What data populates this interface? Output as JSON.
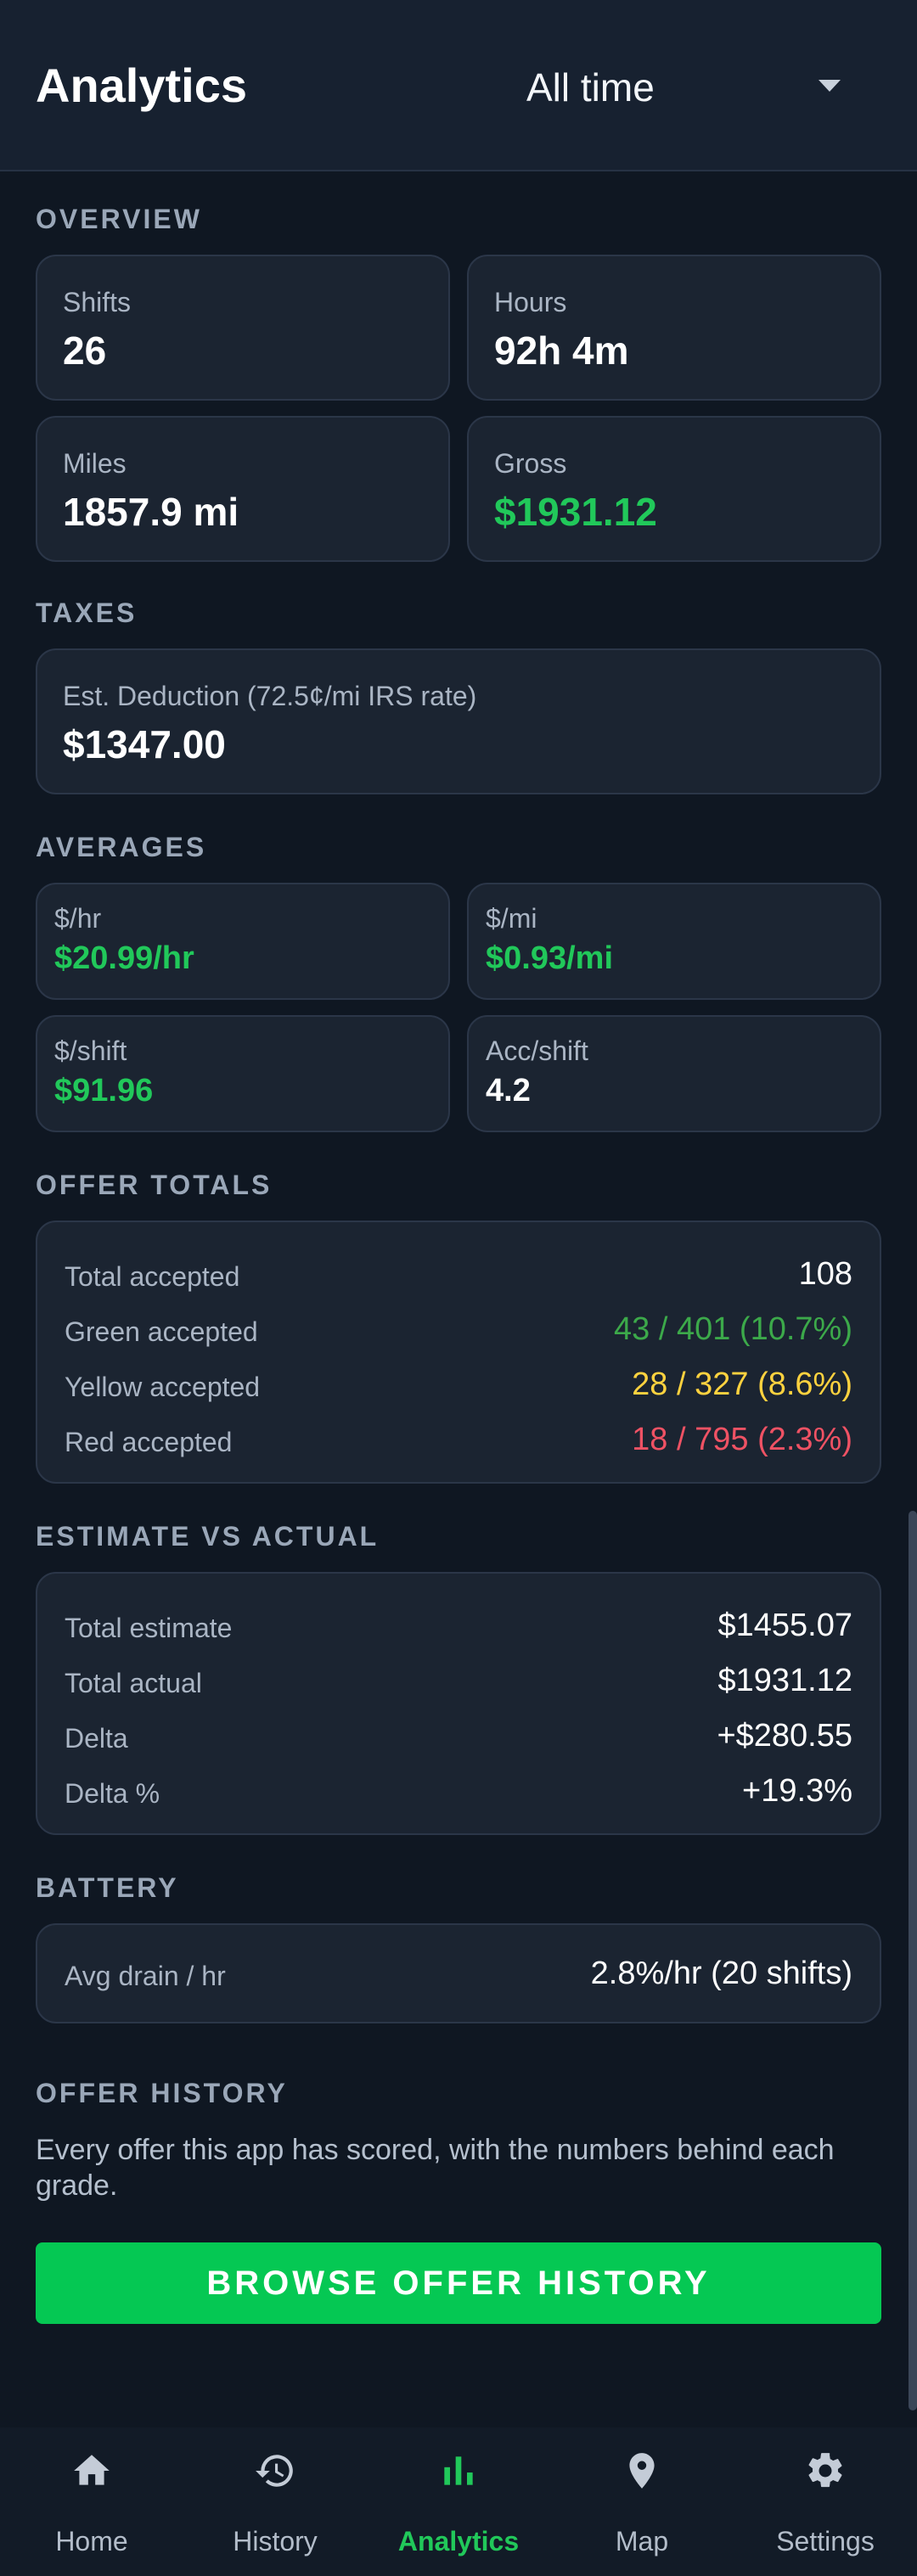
{
  "header": {
    "title": "Analytics",
    "range_value": "All time"
  },
  "overview": {
    "title": "OVERVIEW",
    "cards": [
      {
        "label": "Shifts",
        "value": "26"
      },
      {
        "label": "Hours",
        "value": "92h 4m"
      },
      {
        "label": "Miles",
        "value": "1857.9 mi"
      },
      {
        "label": "Gross",
        "value": "$1931.12"
      }
    ]
  },
  "taxes": {
    "title": "TAXES",
    "label": "Est. Deduction (72.5¢/mi IRS rate)",
    "value": "$1347.00"
  },
  "averages": {
    "title": "AVERAGES",
    "cards": [
      {
        "label": "$/hr",
        "value": "$20.99/hr"
      },
      {
        "label": "$/mi",
        "value": "$0.93/mi"
      },
      {
        "label": "$/shift",
        "value": "$91.96"
      },
      {
        "label": "Acc/shift",
        "value": "4.2"
      }
    ]
  },
  "offer_totals": {
    "title": "OFFER TOTALS",
    "rows": [
      {
        "label": "Total accepted",
        "value": "108"
      },
      {
        "label": "Green accepted",
        "value": "43 / 401 (10.7%)"
      },
      {
        "label": "Yellow accepted",
        "value": "28 / 327 (8.6%)"
      },
      {
        "label": "Red accepted",
        "value": "18 / 795 (2.3%)"
      }
    ]
  },
  "estimate": {
    "title": "ESTIMATE VS ACTUAL",
    "rows": [
      {
        "label": "Total estimate",
        "value": "$1455.07"
      },
      {
        "label": "Total actual",
        "value": "$1931.12"
      },
      {
        "label": "Delta",
        "value": "+$280.55"
      },
      {
        "label": "Delta %",
        "value": "+19.3%"
      }
    ]
  },
  "battery": {
    "title": "BATTERY",
    "label": "Avg drain / hr",
    "value": "2.8%/hr (20 shifts)"
  },
  "offer_history": {
    "title": "OFFER HISTORY",
    "description": "Every offer this app has scored, with the numbers behind each grade.",
    "button_label": "BROWSE OFFER HISTORY"
  },
  "nav": {
    "items": [
      {
        "label": "Home",
        "icon": "home-icon"
      },
      {
        "label": "History",
        "icon": "history-icon"
      },
      {
        "label": "Analytics",
        "icon": "bar-chart-icon",
        "active": true
      },
      {
        "label": "Map",
        "icon": "map-pin-icon"
      },
      {
        "label": "Settings",
        "icon": "gear-icon"
      }
    ]
  },
  "colors": {
    "accent_green": "#21c85a",
    "button_green": "#05c853",
    "yellow": "#ffd23f",
    "red": "#ef5264",
    "background": "#0f1722",
    "card": "#1b2431"
  }
}
